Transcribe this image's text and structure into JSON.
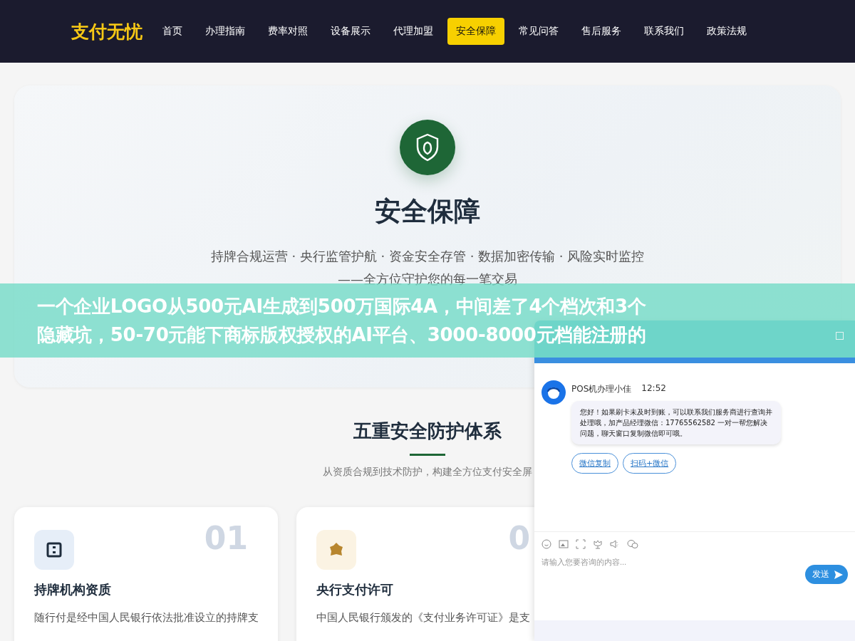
{
  "nav": {
    "logo": "支付无忧",
    "items": [
      {
        "label": "首页",
        "selected": false
      },
      {
        "label": "办理指南",
        "selected": false
      },
      {
        "label": "费率对照",
        "selected": false
      },
      {
        "label": "设备展示",
        "selected": false
      },
      {
        "label": "代理加盟",
        "selected": false
      },
      {
        "label": "安全保障",
        "selected": true
      },
      {
        "label": "常见问答",
        "selected": false
      },
      {
        "label": "售后服务",
        "selected": false
      },
      {
        "label": "联系我们",
        "selected": false
      },
      {
        "label": "政策法规",
        "selected": false
      }
    ]
  },
  "hero": {
    "title": "安全保障",
    "subtitle": "持牌合规运营 · 央行监管护航 · 资金安全存管 · 数据加密传输 · 风险实时监控——全方位守护您的每一笔交易"
  },
  "section": {
    "title": "五重安全防护体系",
    "subtitle": "从资质合规到技术防护，构建全方位支付安全屏"
  },
  "cards": [
    {
      "kind": "grid",
      "number": "01",
      "title": "持牌机构资质",
      "text": "随行付是经中国人民银行依法批准设立的持牌支"
    },
    {
      "kind": "badge",
      "number": "0",
      "title": "央行支付许可",
      "text": "中国人民银行颁发的《支付业务许可证》是支"
    }
  ],
  "banner": {
    "lines": [
      "一个企业LOGO从500元AI生成到500万国际4A，中间差了4个档次和3个",
      "隐藏坑，50-70元能下商标版权授权的AI平台、3000-8000元档能注册的"
    ]
  },
  "chat": {
    "sender": "POS机办理小佳",
    "time": "12:52",
    "message": "您好！如果刷卡未及时到账，可以联系我们服务商进行查询并处理哦，加产品经理微信：17765562582 一对一帮您解决问题，聊天窗口复制微信即可哦。",
    "actions": [
      "微信复制",
      "扫码+微信"
    ],
    "placeholder": "请输入您要咨询的内容...",
    "send": "发送"
  }
}
